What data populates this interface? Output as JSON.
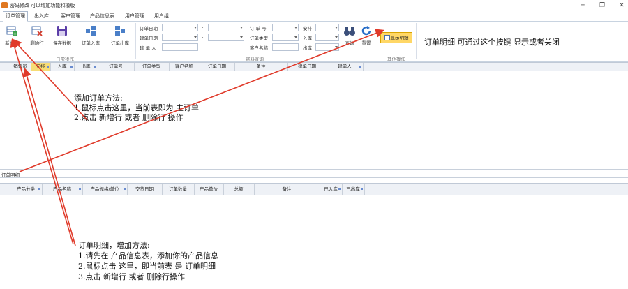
{
  "window": {
    "title": "密码修改 可以增加功能和模版",
    "minimize_glyph": "─",
    "maximize_glyph": "❐",
    "close_glyph": "✕"
  },
  "menu": [
    {
      "label": "订单管理",
      "active": true
    },
    {
      "label": "出入库"
    },
    {
      "label": "客户管理"
    },
    {
      "label": "产品信息表"
    },
    {
      "label": "用户管理"
    },
    {
      "label": "用户组"
    }
  ],
  "ribbon": {
    "buttons": {
      "add_row": "新增行",
      "delete_row": "删除行",
      "save": "保存数据",
      "order_in": "订单入库",
      "order_out": "订单出库",
      "query": "查询",
      "reset": "重置",
      "show_detail": "显示明细"
    },
    "groups": {
      "daily": "日常操作",
      "query": "资料查询",
      "other": "其他操作"
    },
    "fields": {
      "order_date": "订单日期",
      "delivery_date": "建单日期",
      "creator": "建 单 人",
      "order_no": "订 单 号",
      "order_type": "订单类型",
      "customer_name": "客户名称",
      "arrange": "安排",
      "in_stock": "入库",
      "out_stock": "出库",
      "dash": "-"
    }
  },
  "order_grid": {
    "columns": [
      "销售员",
      "安排",
      "入库",
      "出库",
      "订单号",
      "订单类型",
      "客户名称",
      "订单日期",
      "备注",
      "建单日期",
      "建单人"
    ]
  },
  "detail_panel": {
    "label": "订单明细"
  },
  "detail_grid": {
    "columns": [
      "产品分类",
      "产品名称",
      "产品规格/单位",
      "交货日期",
      "订单数量",
      "产品单价",
      "总额",
      "备注",
      "已入库",
      "已出库"
    ]
  },
  "annotations": {
    "top_right": "订单明细 可通过这个按键 显示或者关闭",
    "add_order": [
      "添加订单方法:",
      "1.鼠标点击这里，当前表即为 主订单",
      "2.点击 新增行 或者 删除行 操作"
    ],
    "detail": [
      "订单明细，增加方法:",
      "1.请先在 产品信息表，添加你的产品信息",
      "2.鼠标点击 这里，即当前表 是 订单明细",
      "3.点击 新增行  或者 删除行操作"
    ]
  },
  "colors": {
    "accent": "#ffd766",
    "arrow": "#e03a2a",
    "header_bg": "#eef1f6"
  }
}
